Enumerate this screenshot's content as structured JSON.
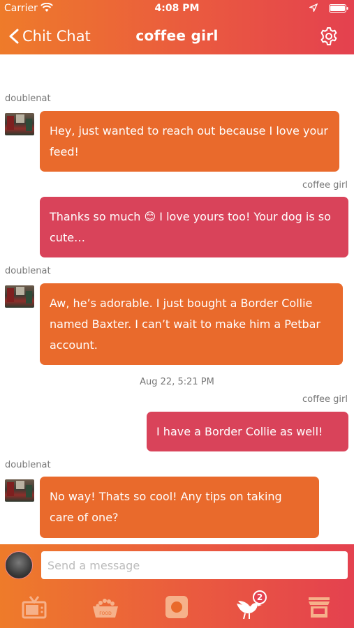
{
  "status_bar": {
    "carrier": "Carrier",
    "time": "4:08 PM"
  },
  "nav": {
    "back_label": "Chit Chat",
    "title": "coffee girl"
  },
  "messages": [
    {
      "sender": "doublenat",
      "direction": "incoming",
      "text": "Hey, just wanted to reach out because I love your feed!"
    },
    {
      "sender": "coffee girl",
      "direction": "outgoing",
      "text": "Thanks so much 😊 I love yours too! Your dog is so cute…"
    },
    {
      "sender": "doublenat",
      "direction": "incoming",
      "text": "Aw, he’s adorable. I just bought a Border Collie named Baxter. I can’t wait to make him a Petbar account."
    },
    {
      "timestamp": "Aug 22, 5:21 PM"
    },
    {
      "sender": "coffee girl",
      "direction": "outgoing",
      "text": "I have a Border Collie as well!"
    },
    {
      "sender": "doublenat",
      "direction": "incoming",
      "text": "No way! Thats so cool! Any tips on taking care of one?"
    }
  ],
  "composer": {
    "placeholder": "Send a message"
  },
  "tabbar": {
    "items": [
      {
        "icon": "tv-icon"
      },
      {
        "icon": "food-bowl-icon",
        "label": "FOOD"
      },
      {
        "icon": "record-icon"
      },
      {
        "icon": "bird-icon",
        "badge": "2"
      },
      {
        "icon": "shop-icon"
      }
    ]
  },
  "colors": {
    "header_gradient_start": "#ee7b2a",
    "header_gradient_end": "#e4414f",
    "incoming_bubble": "#e96a2c",
    "outgoing_bubble": "#d9435a"
  }
}
